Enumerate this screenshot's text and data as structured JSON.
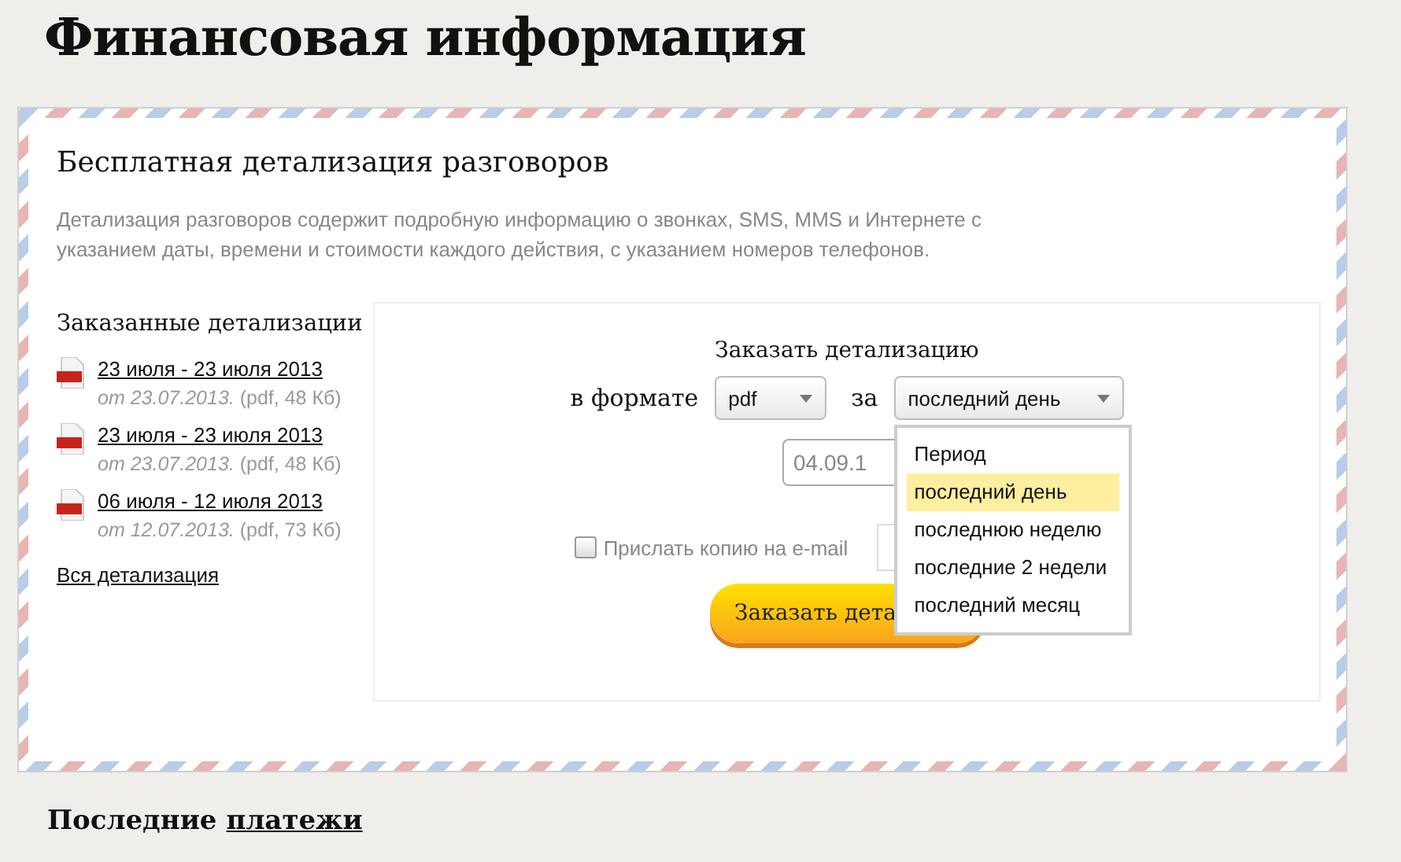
{
  "page_title": "Финансовая информация",
  "card": {
    "title": "Бесплатная детализация разговоров",
    "description": "Детализация разговоров содержит подробную информацию о звонках, SMS, MMS и Интернете с указанием даты, времени и стоимости каждого действия, с указанием номеров телефонов.",
    "orders": {
      "title": "Заказанные детализации",
      "items": [
        {
          "link": "23 июля - 23 июля 2013",
          "date": "от 23.07.2013.",
          "info": "(pdf, 48 Кб)"
        },
        {
          "link": "23 июля - 23 июля 2013",
          "date": "от 23.07.2013.",
          "info": "(pdf, 48 Кб)"
        },
        {
          "link": "06 июля - 12 июля 2013",
          "date": "от 12.07.2013.",
          "info": "(pdf, 73 Кб)"
        }
      ],
      "all_link": "Вся детализация"
    },
    "order_form": {
      "title": "Заказать детализацию",
      "format_label": "в формате",
      "format_value": "pdf",
      "period_label": "за",
      "period_value": "последний день",
      "period_options": [
        {
          "label": "Период",
          "selected": false
        },
        {
          "label": "последний день",
          "selected": true
        },
        {
          "label": "последнюю неделю",
          "selected": false
        },
        {
          "label": "последние 2 недели",
          "selected": false
        },
        {
          "label": "последний месяц",
          "selected": false
        }
      ],
      "date_value": "04.09.1",
      "email_copy": {
        "label": "Прислать копию на e-mail",
        "checked": false
      },
      "submit": "Заказать дета"
    }
  },
  "section": {
    "text": "Последние",
    "link": "платежи"
  }
}
